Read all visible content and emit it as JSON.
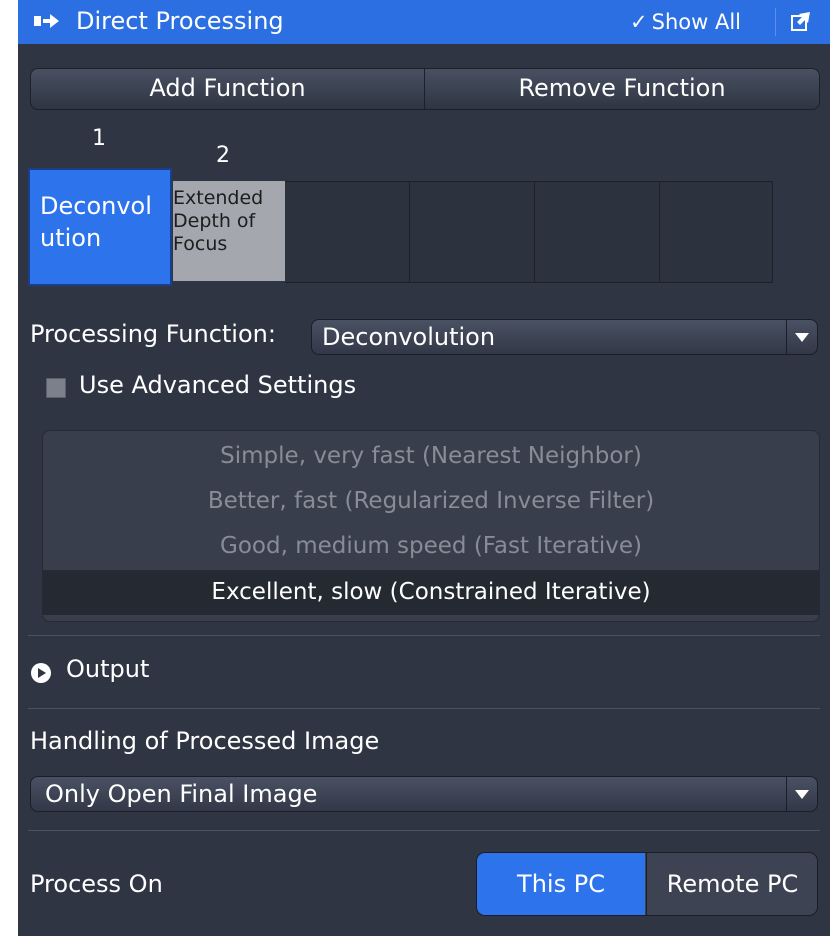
{
  "header": {
    "title": "Direct Processing",
    "show_all_check": "✓",
    "show_all_label": "Show All",
    "title_icon": "arrow-right-icon",
    "undock_icon": "undock-icon"
  },
  "toolbar": {
    "add_function": "Add Function",
    "remove_function": "Remove Function"
  },
  "pipeline": {
    "functions": [
      {
        "number": "1",
        "label": "Deconvol ution",
        "selected": true
      },
      {
        "number": "2",
        "label": "Extended Depth of Focus",
        "selected": false
      }
    ]
  },
  "processing_function": {
    "label": "Processing Function:",
    "value": "Deconvolution"
  },
  "advanced": {
    "label": "Use Advanced Settings",
    "checked": false
  },
  "methods": {
    "options": [
      "Simple, very fast (Nearest Neighbor)",
      "Better, fast (Regularized Inverse Filter)",
      "Good, medium speed (Fast Iterative)",
      "Excellent, slow (Constrained Iterative)"
    ],
    "selected_index": 3
  },
  "output": {
    "label": "Output",
    "icon": "expand-arrow-icon"
  },
  "handling": {
    "label": "Handling of Processed Image",
    "value": "Only Open Final Image"
  },
  "process_on": {
    "label": "Process On",
    "options": [
      "This PC",
      "Remote PC"
    ],
    "selected_index": 0
  },
  "colors": {
    "accent": "#2d74ec",
    "panel_bg": "#2f3542",
    "title_bar": "#2b6fe2"
  }
}
